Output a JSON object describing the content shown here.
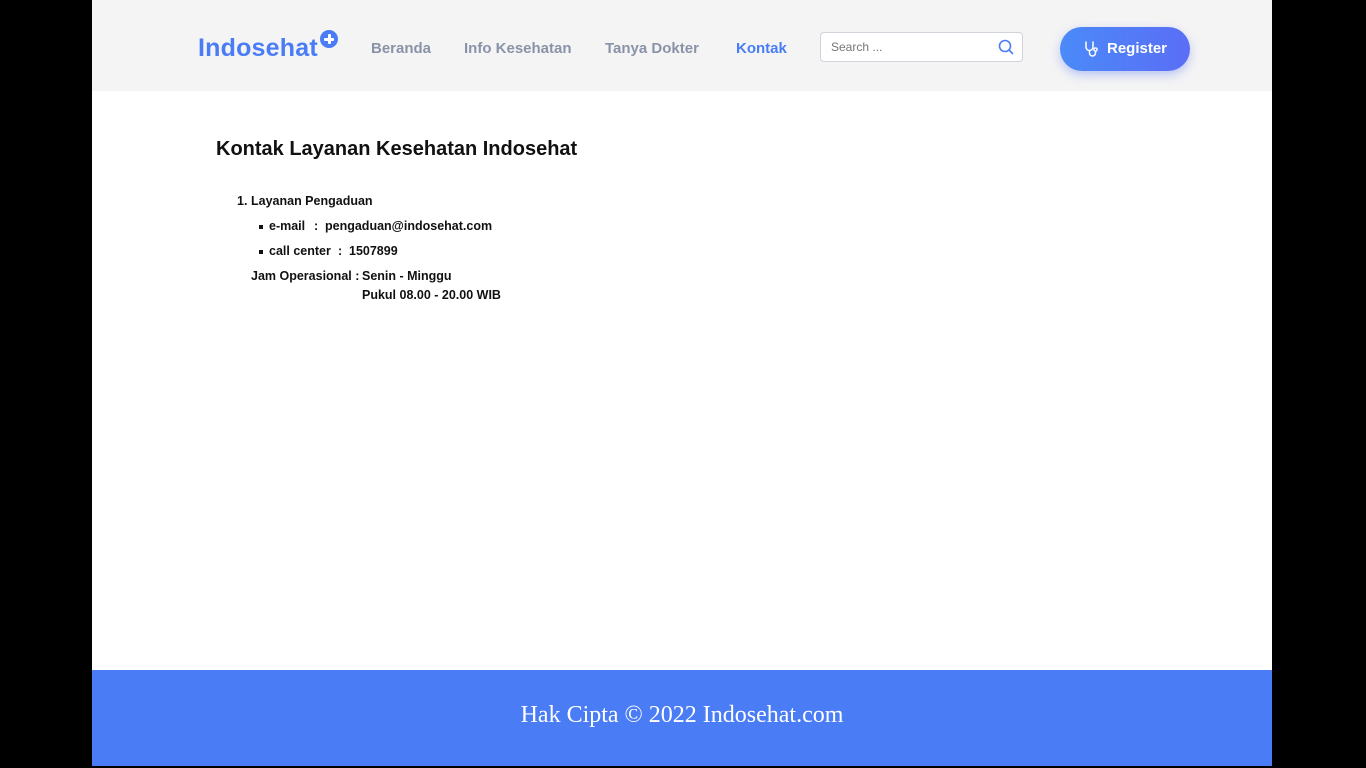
{
  "header": {
    "logo": "Indosehat",
    "nav": [
      {
        "label": "Beranda"
      },
      {
        "label": "Info Kesehatan"
      },
      {
        "label": "Tanya Dokter"
      },
      {
        "label": "Kontak"
      }
    ],
    "active_nav": "Kontak",
    "search_placeholder": "Search ...",
    "register_label": "Register"
  },
  "main": {
    "title": "Kontak Layanan Kesehatan Indosehat",
    "service": {
      "number": "1.",
      "name": "Layanan Pengaduan",
      "email_label": "e-mail",
      "email_sep": ":",
      "email_value": "pengaduan@indosehat.com",
      "call_label": "call center",
      "call_sep": ":",
      "call_value": "1507899",
      "hours_label": "Jam Operasional :",
      "hours_days": "Senin - Minggu",
      "hours_time": "Pukul 08.00 - 20.00 WIB"
    }
  },
  "footer": {
    "copyright": "Hak Cipta © 2022 Indosehat.com"
  },
  "colors": {
    "brand": "#4a7cf6",
    "nav_text": "#8993a8",
    "header_bg": "#f4f4f4",
    "footer_bg": "#4a7cf6"
  },
  "icons": {
    "logo_badge": "plus-circle-icon",
    "search": "search-icon",
    "register": "stethoscope-icon"
  }
}
